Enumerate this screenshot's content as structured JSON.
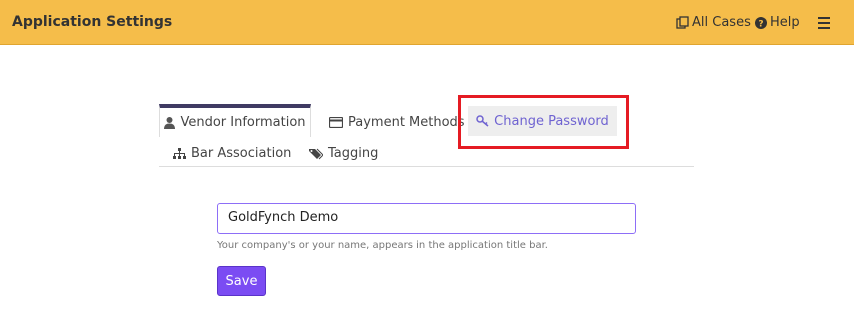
{
  "header": {
    "title": "Application Settings",
    "all_cases_label": "All Cases",
    "help_label": "Help"
  },
  "tabs": [
    {
      "label": "Vendor Information",
      "icon": "user-icon"
    },
    {
      "label": "Payment Methods",
      "icon": "credit-card-icon"
    },
    {
      "label": "Change Password",
      "icon": "key-icon"
    },
    {
      "label": "Bar Association",
      "icon": "sitemap-icon"
    },
    {
      "label": "Tagging",
      "icon": "tags-icon"
    }
  ],
  "form": {
    "company_name_value": "GoldFynch Demo",
    "help_text": "Your company's or your name, appears in the application title bar.",
    "save_label": "Save"
  },
  "colors": {
    "header_bg": "#f5bd4a",
    "accent": "#7b4cf3",
    "highlight_box": "#e51b23"
  }
}
